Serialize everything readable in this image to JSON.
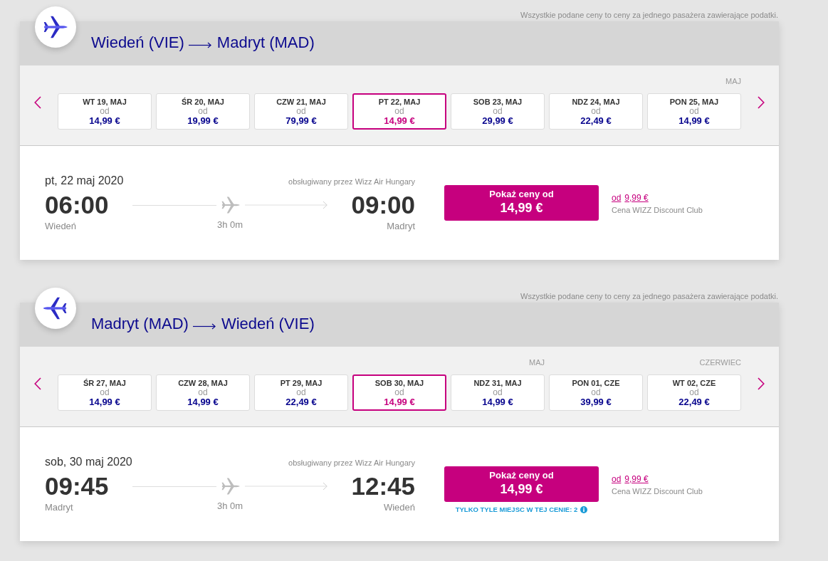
{
  "segments": [
    {
      "kind": "outbound",
      "price_notice": "Wszystkie podane ceny to ceny za jednego pasażera zawierające podatki.",
      "route": {
        "from": "Wiedeń (VIE)",
        "to": "Madryt (MAD)"
      },
      "dates": [
        {
          "day": "WT 19, MAJ",
          "from_label": "od",
          "price": "14,99 €",
          "selected": false
        },
        {
          "day": "ŚR 20, MAJ",
          "from_label": "od",
          "price": "19,99 €",
          "selected": false
        },
        {
          "day": "CZW 21, MAJ",
          "from_label": "od",
          "price": "79,99 €",
          "selected": false
        },
        {
          "day": "PT 22, MAJ",
          "from_label": "od",
          "price": "14,99 €",
          "selected": true
        },
        {
          "day": "SOB 23, MAJ",
          "from_label": "od",
          "price": "29,99 €",
          "selected": false
        },
        {
          "day": "NDZ 24, MAJ",
          "from_label": "od",
          "price": "22,49 €",
          "selected": false
        },
        {
          "month": "MAJ",
          "day": "PON 25, MAJ",
          "from_label": "od",
          "price": "14,99 €",
          "selected": false
        }
      ],
      "flight": {
        "date": "pt, 22 maj 2020",
        "operator": "obsługiwany przez Wizz Air Hungary",
        "departure_time": "06:00",
        "departure_city": "Wiedeń",
        "duration": "3h 0m",
        "arrival_time": "09:00",
        "arrival_city": "Madryt",
        "button": {
          "label": "Pokaż ceny od",
          "price": "14,99 €"
        },
        "discount": {
          "from_label": "od",
          "price": "9,99 €",
          "label": "Cena WIZZ Discount Club"
        }
      }
    },
    {
      "kind": "return",
      "price_notice": "Wszystkie podane ceny to ceny za jednego pasażera zawierające podatki.",
      "route": {
        "from": "Madryt (MAD)",
        "to": "Wiedeń (VIE)"
      },
      "dates": [
        {
          "day": "ŚR 27, MAJ",
          "from_label": "od",
          "price": "14,99 €",
          "selected": false
        },
        {
          "day": "CZW 28, MAJ",
          "from_label": "od",
          "price": "14,99 €",
          "selected": false
        },
        {
          "day": "PT 29, MAJ",
          "from_label": "od",
          "price": "22,49 €",
          "selected": false
        },
        {
          "day": "SOB 30, MAJ",
          "from_label": "od",
          "price": "14,99 €",
          "selected": true
        },
        {
          "month": "MAJ",
          "day": "NDZ 31, MAJ",
          "from_label": "od",
          "price": "14,99 €",
          "selected": false
        },
        {
          "day": "PON 01, CZE",
          "from_label": "od",
          "price": "39,99 €",
          "selected": false
        },
        {
          "month": "CZERWIEC",
          "day": "WT 02, CZE",
          "from_label": "od",
          "price": "22,49 €",
          "selected": false
        }
      ],
      "flight": {
        "date": "sob, 30 maj 2020",
        "operator": "obsługiwany przez Wizz Air Hungary",
        "departure_time": "09:45",
        "departure_city": "Madryt",
        "duration": "3h 0m",
        "arrival_time": "12:45",
        "arrival_city": "Wiedeń",
        "button": {
          "label": "Pokaż ceny od",
          "price": "14,99 €"
        },
        "discount": {
          "from_label": "od",
          "price": "9,99 €",
          "label": "Cena WIZZ Discount Club"
        },
        "seats_notice": "TYLKO TYLE MIEJSC W TEJ CENIE: 2"
      }
    }
  ]
}
